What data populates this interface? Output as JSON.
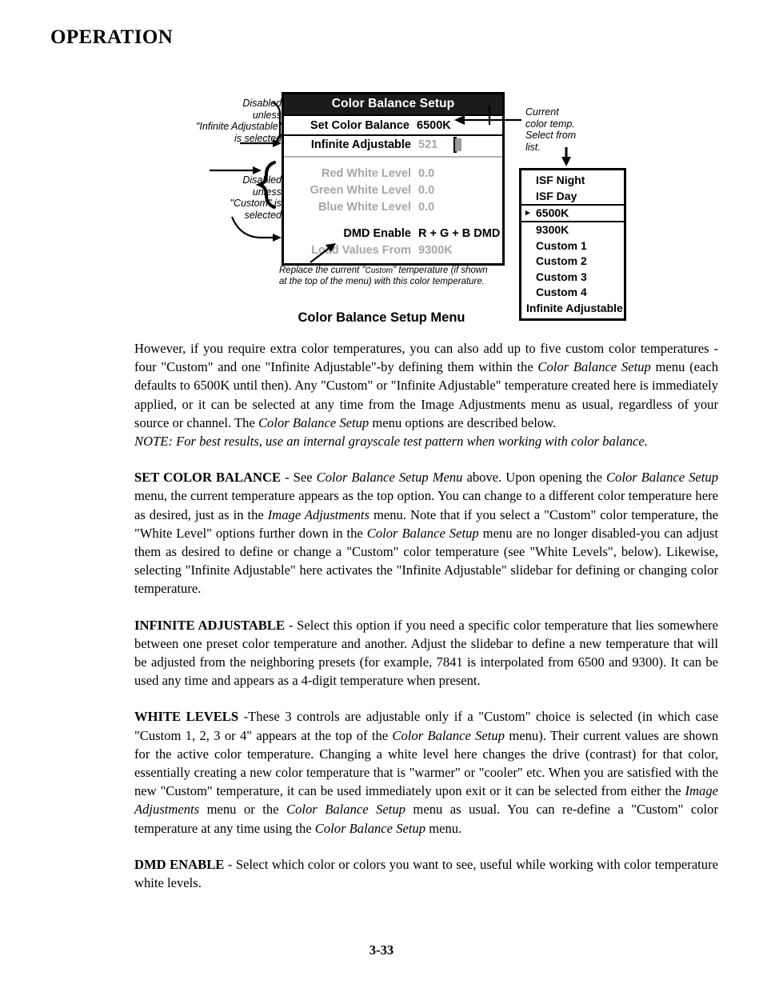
{
  "page": {
    "heading": "OPERATION",
    "number": "3-33"
  },
  "figure": {
    "caption": "Color Balance Setup Menu",
    "osd": {
      "title": "Color Balance Setup",
      "rows": [
        {
          "label": "Set Color Balance",
          "value": "6500K",
          "dim": false,
          "selected": true
        },
        {
          "label": "Infinite Adjustable",
          "value": "521",
          "dim": false,
          "slider": true
        },
        {
          "label": "Red White Level",
          "value": "0.0",
          "dim": true
        },
        {
          "label": "Green White Level",
          "value": "0.0",
          "dim": true
        },
        {
          "label": "Blue White Level",
          "value": "0.0",
          "dim": true
        },
        {
          "label": "DMD Enable",
          "value": "R + G + B DMD",
          "dim": false
        },
        {
          "label": "Load Values From",
          "value": "9300K",
          "dim": true
        }
      ],
      "slider_value": "521"
    },
    "annotations": {
      "left_top": "Disabled\nunless\n\"Infinite Adjustable\"\nis selected",
      "left_bottom": "Disabled\nunless\n\"Custom\" is\nselected",
      "right_top": "Current\ncolor temp.\nSelect from\nlist.",
      "note_line1_a": "Replace the current \"",
      "note_line1_b": "Custom",
      "note_line1_c": "\" temperature (if shown",
      "note_line2": "at the top of the menu) with this color temperature."
    },
    "dropdown": {
      "selected": "6500K",
      "marker": "▸",
      "items": [
        "ISF Night",
        "ISF Day",
        "6500K",
        "9300K",
        "Custom 1",
        "Custom 2",
        "Custom 3",
        "Custom 4",
        "Infinite Adjustable"
      ]
    }
  },
  "body": {
    "p1": {
      "text": "However, if you require extra color temperatures, you can also add up to five custom color temperatures - four \"Custom\" and one \"Infinite Adjustable\"-by defining them within the ",
      "it1": "Color Balance Setup",
      "text2": " menu (each defaults to 6500K until then). Any \"Custom\" or \"Infinite Adjustable\" temperature created here is immediately applied, or it can be selected at any time from the Image Adjustments menu as usual, regardless of your source or channel. The ",
      "it2": "Color Balance Setup",
      "text3": " menu options are described below."
    },
    "note": "NOTE: For best results, use an internal grayscale test pattern when working with color balance.",
    "p2": {
      "head": "SET COLOR BALANCE",
      "t1": " - See ",
      "i1": "Color Balance Setup Menu",
      "t2": " above. Upon opening the ",
      "i2": "Color Balance Setup",
      "t3": " menu, the current temperature appears as the top option. You can change to a different color temperature here as desired, just as in the ",
      "i3": "Image Adjustments",
      "t4": " menu. Note that if you select a \"Custom\" color temperature, the \"White Level\" options further down in the ",
      "i4": "Color Balance Setup",
      "t5": " menu are no longer disabled-you can adjust them as desired to define or change a \"Custom\" color temperature (see \"White Levels\", below). Likewise, selecting \"Infinite Adjustable\" here activates the \"Infinite Adjustable\" slidebar for defining or changing color temperature."
    },
    "p3": {
      "head": "INFINITE ADJUSTABLE",
      "t1": " - Select this option if you need a specific color temperature that lies somewhere between one preset color temperature and another. Adjust the slidebar to define a new temperature that will be adjusted from the neighboring presets (for example, 7841 is interpolated from 6500 and 9300). It can be used any time and appears as a 4-digit temperature when present."
    },
    "p4": {
      "head": "WHITE LEVELS",
      "t1": " -These 3 controls are adjustable only if a \"Custom\" choice is selected (in which case \"Custom 1, 2, 3 or 4\" appears at the top of the ",
      "i1": "Color Balance Setup",
      "t2": " menu). Their current values are shown for the active color temperature. Changing a white level here changes the drive (contrast) for that color, essentially creating a new color temperature that is \"warmer\" or \"cooler\" etc. When you are satisfied with the new \"Custom\" temperature, it can be used immediately upon exit or it can be selected from either the ",
      "i2": "Image Adjustments",
      "t3": " menu or the ",
      "i3": "Color Balance",
      "i3b": "Setup",
      "t4": " menu as usual. You can re-define a \"Custom\" color temperature at any time using the ",
      "i4": "Color Balance Setup",
      "t5": " menu."
    },
    "p5": {
      "head": "DMD ENABLE",
      "t1": " - Select which color or colors you want to see, useful while working with color temperature white levels."
    }
  }
}
